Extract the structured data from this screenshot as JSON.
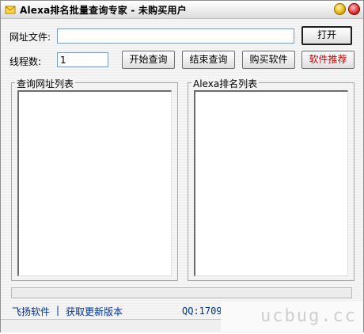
{
  "window": {
    "title": "Alexa排名批量查询专家 - 未购买用户",
    "icon": "envelope-icon"
  },
  "form": {
    "url_file_label": "网址文件:",
    "url_file_value": "",
    "open_button": "打开",
    "threads_label": "线程数:",
    "threads_value": "1",
    "start_button": "开始查询",
    "stop_button": "结束查询",
    "buy_button": "购买软件",
    "recommend_button": "软件推荐",
    "recommend_color": "#d40000"
  },
  "groups": {
    "query_list_title": "查询网址列表",
    "rank_list_title": "Alexa排名列表"
  },
  "progress": {
    "value": 0
  },
  "footer": {
    "link_feiyang": "飞扬软件",
    "separator": "|",
    "link_update": "获取更新版本",
    "qq_text": "QQ:17090"
  },
  "watermark": {
    "text": "ucbug.cc"
  }
}
